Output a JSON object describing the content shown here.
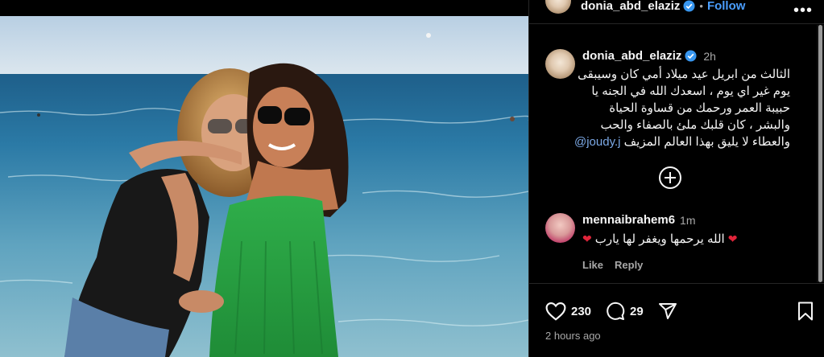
{
  "post": {
    "author": "donia_abd_elaziz",
    "follow_label": "Follow",
    "more_label": "•••",
    "caption_time": "2h",
    "caption_text": "الثالث من ابريل عيد ميلاد أمي كان وسيبقى يوم غير اي يوم ، اسعدك الله في الجنه يا حبيبة العمر ورحمك من قساوة الحياة والبشر ، كان قلبك ملئ بالصفاء والحب والعطاء لا يليق بهذا العالم المزيف",
    "caption_mention": "@joudy.j",
    "likes": "230",
    "comments_count": "29",
    "posted_ago": "2 hours ago"
  },
  "comment": {
    "author": "mennaibrahem6",
    "time": "1m",
    "text": "الله يرحمها ويغفر لها يارب",
    "hearts": "❤",
    "like_label": "Like",
    "reply_label": "Reply"
  },
  "icons": {
    "verified": "verified-badge-icon",
    "like": "heart-icon",
    "comment": "comment-icon",
    "share": "share-icon",
    "save": "bookmark-icon",
    "load_more": "plus-circle-icon"
  },
  "colors": {
    "accent": "#4a9eff",
    "verified": "#3897f0",
    "heart": "#e0243a"
  }
}
